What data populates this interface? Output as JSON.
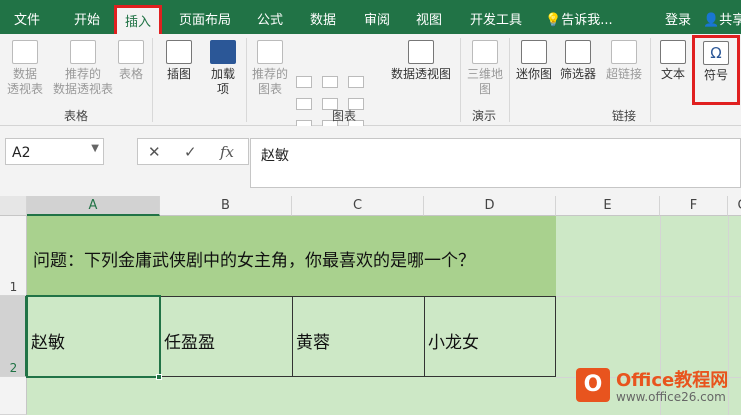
{
  "tabs": [
    "文件",
    "开始",
    "插入",
    "页面布局",
    "公式",
    "数据",
    "审阅",
    "视图",
    "开发工具"
  ],
  "tell_me": "告诉我...",
  "login": "登录",
  "share": "共享",
  "ribbon": {
    "pivot_table": "数据\n透视表",
    "recommended_pivot": "推荐的\n数据透视表",
    "table": "表格",
    "group_tables": "表格",
    "illustrations": "插图",
    "addins": "加载\n项",
    "recommended_charts": "推荐的\n图表",
    "pivot_chart": "数据透视图",
    "group_charts": "图表",
    "map3d": "三维地\n图",
    "group_tours": "演示",
    "sparklines": "迷你图",
    "filters": "筛选器",
    "hyperlink": "超链接",
    "group_links": "链接",
    "text": "文本",
    "symbols": "符号",
    "accent_red": "#e02020",
    "accent_green": "#217346"
  },
  "formula_bar": {
    "name_box": "A2",
    "fx": "fx",
    "value": "赵敏"
  },
  "columns": [
    "A",
    "B",
    "C",
    "D",
    "E",
    "F",
    "G"
  ],
  "rows": [
    "1",
    "2"
  ],
  "cells": {
    "A1": "问题：下列金庸武侠剧中的女主角，你最喜欢的是哪一个？",
    "A2": "赵敏",
    "B2": "任盈盈",
    "C2": "黄蓉",
    "D2": "小龙女"
  },
  "watermark": {
    "brand": "Office教程网",
    "url": "www.office26.com"
  }
}
